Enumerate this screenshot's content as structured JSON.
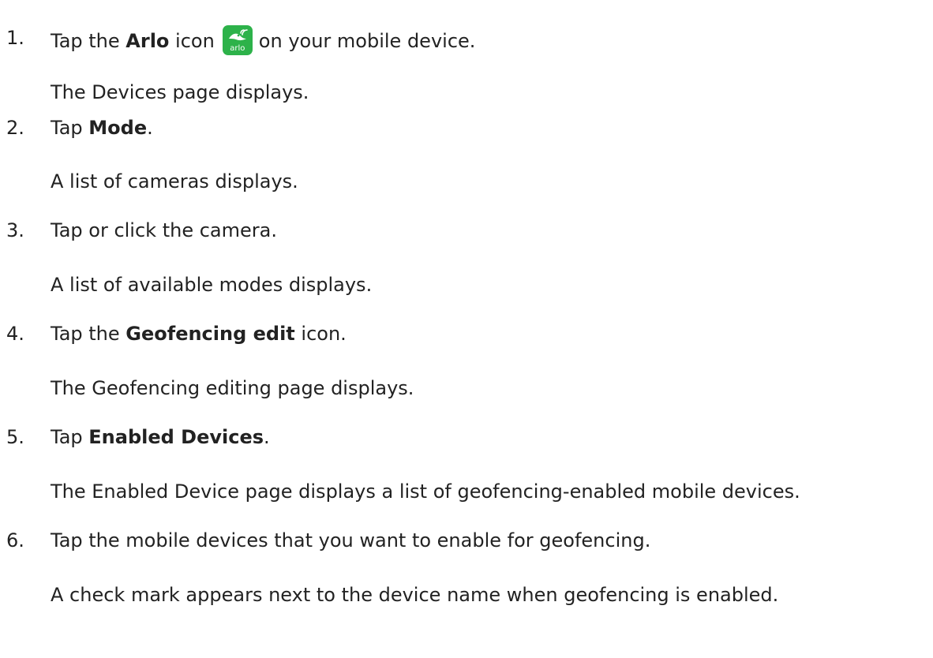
{
  "steps": [
    {
      "number": "1.",
      "before": "Tap the ",
      "bold": "Arlo",
      "after": " icon",
      "after2": "on your mobile device.",
      "result": "The Devices page displays.",
      "icon": {
        "name": "arlo-app-icon",
        "word": "arlo",
        "color": "#2db24a"
      }
    },
    {
      "number": "2.",
      "before": "Tap ",
      "bold": "Mode",
      "after": ".",
      "result": "A list of cameras displays."
    },
    {
      "number": "3.",
      "before": "Tap or click the camera.",
      "result": "A list of available modes displays."
    },
    {
      "number": "4.",
      "before": "Tap the ",
      "bold": "Geofencing edit",
      "after": " icon.",
      "result": "The Geofencing editing page displays."
    },
    {
      "number": "5.",
      "before": "Tap ",
      "bold": "Enabled Devices",
      "after": ".",
      "result": "The Enabled Device page displays a list of geofencing-enabled mobile devices."
    },
    {
      "number": "6.",
      "before": "Tap the mobile devices that you want to enable for geofencing.",
      "result": "A check mark appears next to the device name when geofencing is enabled."
    }
  ]
}
